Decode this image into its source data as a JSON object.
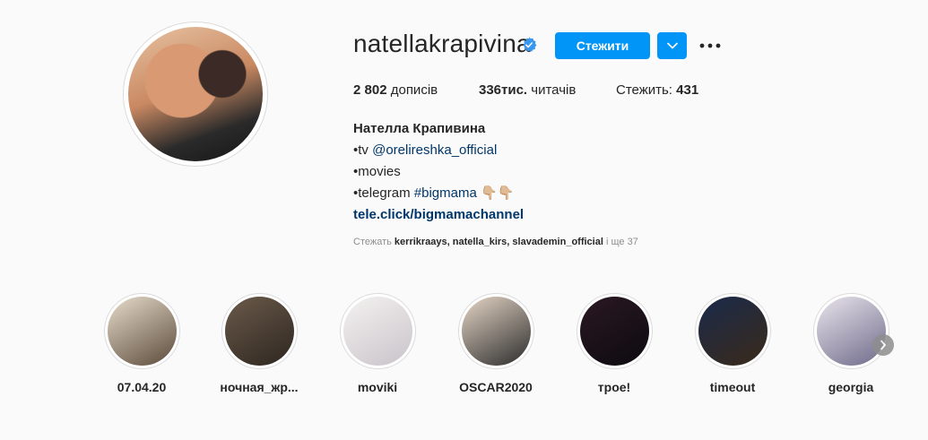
{
  "profile": {
    "username": "natellakrapivina",
    "follow_label": "Стежити",
    "stats": {
      "posts_value": "2 802",
      "posts_label": "дописів",
      "followers_value": "336тис.",
      "followers_label": "читачів",
      "following_label": "Стежить:",
      "following_value": "431"
    },
    "bio": {
      "name": "Нателла Крапивина",
      "line1_prefix": "•tv ",
      "line1_link": "@orelireshka_official",
      "line2": "•movies",
      "line3_prefix": "•telegram ",
      "line3_link": "#bigmama",
      "line3_emoji": "👇🏼👇🏼",
      "url": "tele.click/bigmamachannel"
    },
    "followed_by": {
      "prefix": "Стежать",
      "users": "kerrikraays, natella_kirs, slavademin_official",
      "suffix": "і ще 37"
    }
  },
  "highlights": [
    {
      "label": "07.04.20",
      "colors": [
        "#e7dccb",
        "#5b4a3a"
      ]
    },
    {
      "label": "ночная_жр...",
      "colors": [
        "#6b5a4a",
        "#2d2620"
      ]
    },
    {
      "label": "moviki",
      "colors": [
        "#f4f2f1",
        "#c9c3c9"
      ]
    },
    {
      "label": "OSCAR2020",
      "colors": [
        "#e6d6c6",
        "#2b2b2b"
      ]
    },
    {
      "label": "трое!",
      "colors": [
        "#2a1823",
        "#0d0a10"
      ]
    },
    {
      "label": "timeout",
      "colors": [
        "#1a2a4a",
        "#3a2a1a"
      ]
    },
    {
      "label": "georgia",
      "colors": [
        "#e9e5ec",
        "#6f6a8a"
      ]
    }
  ],
  "colors": {
    "accent": "#0095f6",
    "link": "#00376b",
    "verified": "#3897f0"
  }
}
